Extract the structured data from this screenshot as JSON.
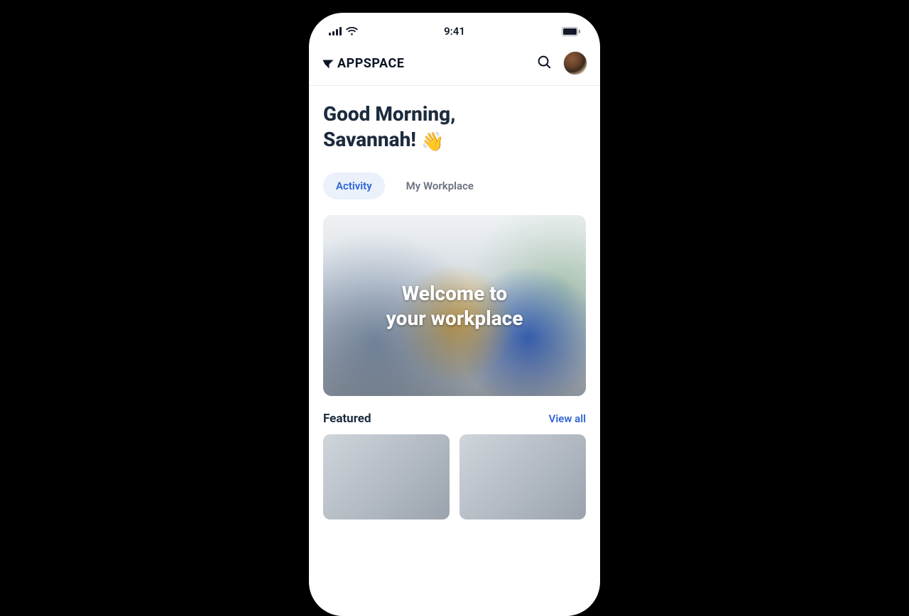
{
  "status_bar": {
    "time": "9:41"
  },
  "header": {
    "brand": "APPSPACE"
  },
  "greeting": {
    "line1": "Good Morning,",
    "line2": "Savannah!",
    "emoji": "👋"
  },
  "tabs": {
    "activity": "Activity",
    "my_workplace": "My Workplace"
  },
  "hero": {
    "line1": "Welcome to",
    "line2": "your workplace"
  },
  "featured": {
    "title": "Featured",
    "view_all": "View all"
  }
}
